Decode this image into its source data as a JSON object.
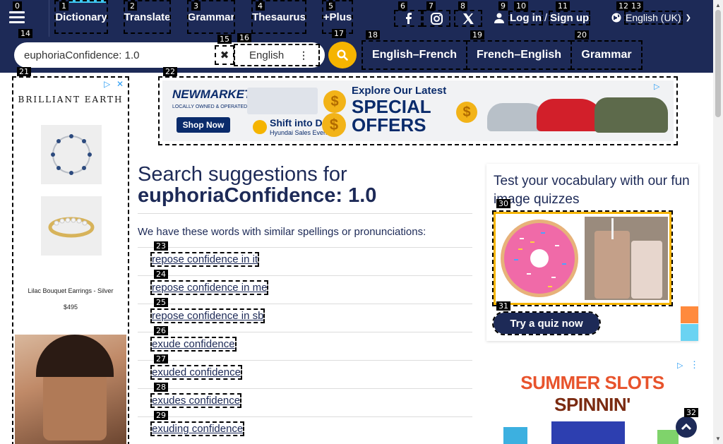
{
  "nav": {
    "links": [
      "Dictionary",
      "Translate",
      "Grammar",
      "Thesaurus",
      "+Plus"
    ],
    "login": "Log in",
    "separator": "/",
    "signup": "Sign up",
    "language": "English (UK)"
  },
  "search": {
    "value": "euphoriaConfidence: 1.0",
    "dictionary": "English",
    "tools": [
      "English–French",
      "French–English",
      "Grammar"
    ]
  },
  "ad_left": {
    "brand": "BRILLIANT EARTH",
    "caption": "Lilac Bouquet Earrings - Silver",
    "price": "$495"
  },
  "banner": {
    "brand": "NEWMARKET HYUNDAI",
    "tagline": "LOCALLY OWNED & OPERATED",
    "cta": "Shop Now",
    "headline_small": "Explore Our Latest",
    "headline_big": "SPECIAL OFFERS",
    "promo": "Shift into Drive",
    "promo_sub": "Hyundai Sales Event"
  },
  "main": {
    "heading_prefix": "Search suggestions for",
    "query": "euphoriaConfidence: 1.0",
    "intro": "We have these words with similar spellings or pronunciations:",
    "suggestions": [
      "repose confidence in it",
      "repose confidence in me",
      "repose confidence in sb",
      "exude confidence",
      "exuded confidence",
      "exudes confidence",
      "exuding confidence"
    ]
  },
  "quiz": {
    "title": "Test your vocabulary with our fun image quizzes",
    "button": "Try a quiz now"
  },
  "slots": {
    "title_a": "SUMMER SLOTS ",
    "title_b": "SPINNIN'"
  },
  "tags": [
    "0",
    "1",
    "2",
    "3",
    "4",
    "5",
    "6",
    "7",
    "8",
    "9",
    "10",
    "11",
    "12",
    "13",
    "14",
    "15",
    "16",
    "17",
    "18",
    "19",
    "20",
    "21",
    "22",
    "23",
    "24",
    "25",
    "26",
    "27",
    "28",
    "29",
    "30",
    "31",
    "32"
  ],
  "colors": {
    "navy": "#1d2a57",
    "accent_yellow": "#f5b400",
    "accent_cyan": "#3fc7f0"
  }
}
